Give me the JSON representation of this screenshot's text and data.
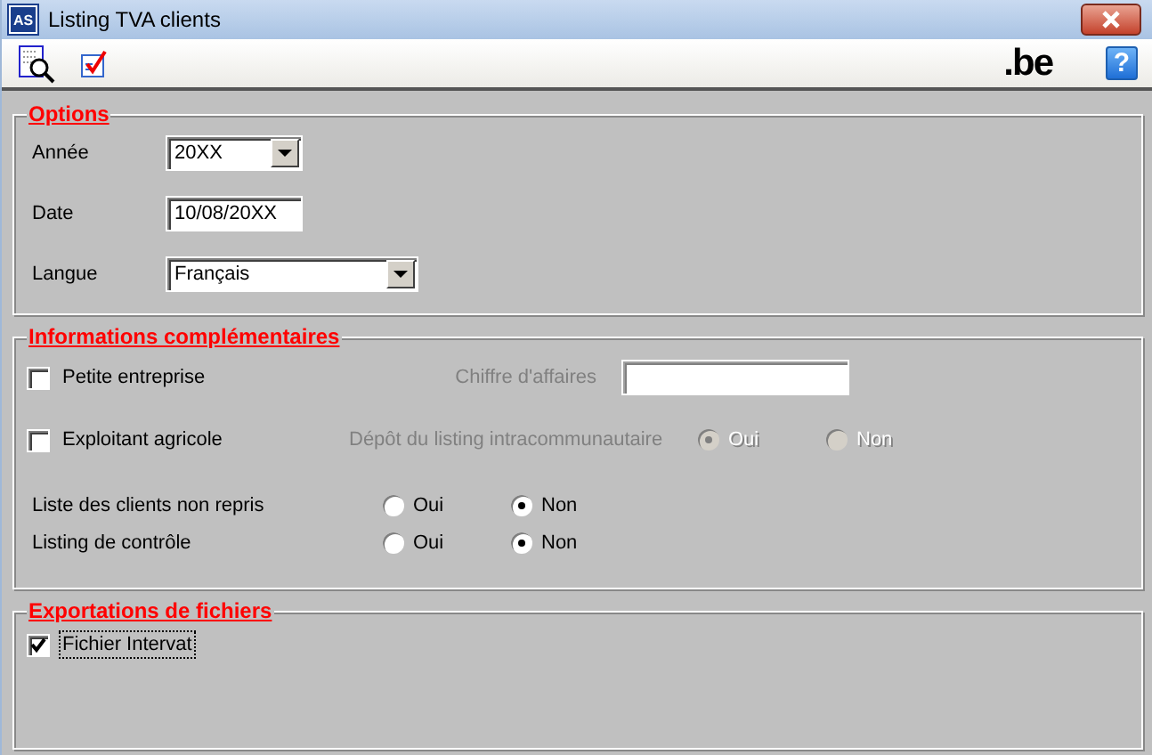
{
  "window": {
    "title": "Listing TVA clients",
    "app_icon_text": "AS"
  },
  "toolbar": {
    "logo_text": ".be",
    "help_text": "?"
  },
  "options": {
    "legend": "Options",
    "fields": [
      {
        "kind": "select",
        "label": "Année",
        "value": "20XX"
      },
      {
        "kind": "input",
        "label": "Date",
        "value": "10/08/20XX"
      },
      {
        "kind": "select",
        "label": "Langue",
        "value": "Français"
      }
    ]
  },
  "info": {
    "legend": "Informations complémentaires",
    "rows": [
      {
        "kind": "check_field",
        "label": "Petite entreprise",
        "checked": false,
        "field_label": "Chiffre d'affaires",
        "disabled": true
      },
      {
        "kind": "check_radio",
        "label": "Exploitant agricole",
        "checked": false,
        "group_label": "Dépôt du listing intracommunautaire",
        "disabled": true,
        "options": [
          {
            "label": "Oui",
            "selected": true
          },
          {
            "label": "Non",
            "selected": false
          }
        ]
      },
      {
        "kind": "radio",
        "label": "Liste des clients non repris",
        "disabled": false,
        "options": [
          {
            "label": "Oui",
            "selected": false
          },
          {
            "label": "Non",
            "selected": true
          }
        ]
      },
      {
        "kind": "radio",
        "label": "Listing de contrôle",
        "disabled": false,
        "options": [
          {
            "label": "Oui",
            "selected": false
          },
          {
            "label": "Non",
            "selected": true
          }
        ]
      }
    ]
  },
  "export": {
    "legend": "Exportations de fichiers",
    "items": [
      {
        "label": "Fichier Intervat",
        "checked": true,
        "focused": true
      }
    ]
  }
}
